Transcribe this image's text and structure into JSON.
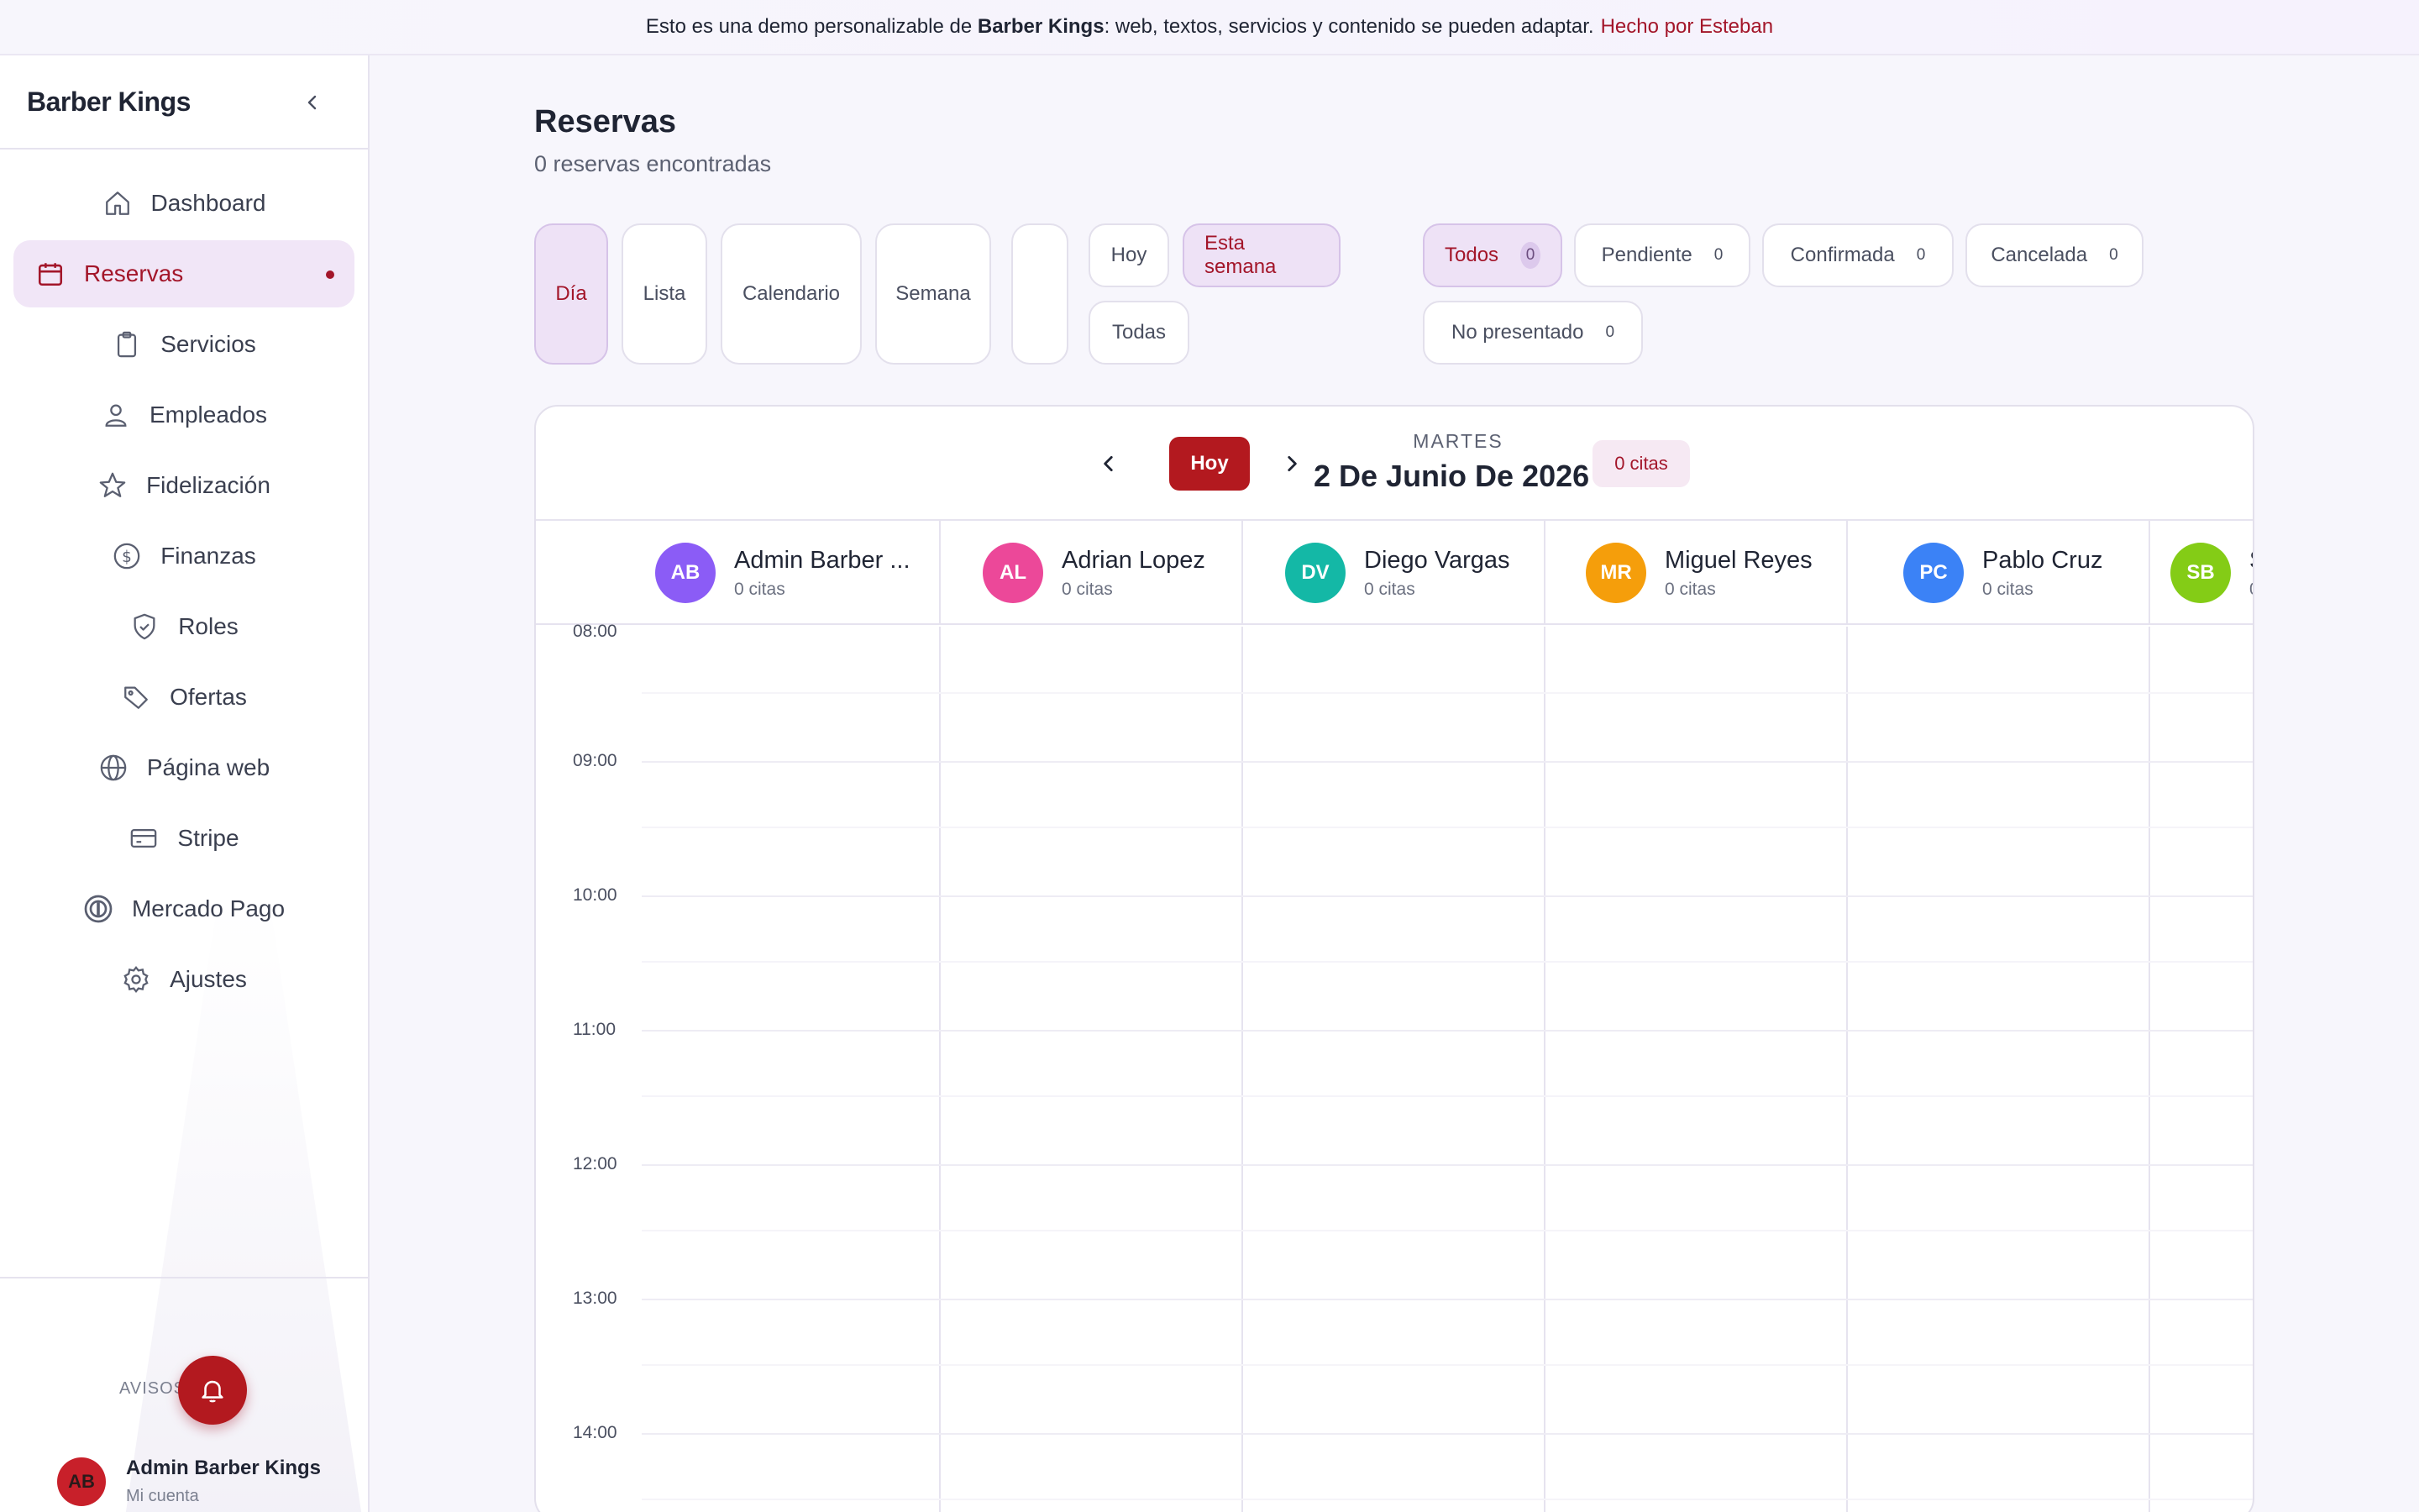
{
  "banner": {
    "prefix": "Esto es una demo personalizable de",
    "brand": "Barber Kings",
    "suffix": ": web, textos, servicios y contenido se pueden adaptar.",
    "credit": "Hecho por Esteban"
  },
  "sidebar": {
    "brand": "Barber Kings",
    "items": [
      {
        "label": "Dashboard",
        "icon": "home-icon"
      },
      {
        "label": "Reservas",
        "icon": "calendar-icon",
        "active": true
      },
      {
        "label": "Servicios",
        "icon": "clipboard-icon"
      },
      {
        "label": "Empleados",
        "icon": "users-icon"
      },
      {
        "label": "Fidelización",
        "icon": "star-icon"
      },
      {
        "label": "Finanzas",
        "icon": "dollar-icon"
      },
      {
        "label": "Roles",
        "icon": "shield-icon"
      },
      {
        "label": "Ofertas",
        "icon": "tag-icon"
      },
      {
        "label": "Página web",
        "icon": "globe-icon"
      },
      {
        "label": "Stripe",
        "icon": "card-icon"
      },
      {
        "label": "Mercado Pago",
        "icon": "mercado-pago-icon"
      },
      {
        "label": "Ajustes",
        "icon": "gear-icon"
      }
    ],
    "avisos_label": "AVISOS",
    "account": {
      "initials": "AB",
      "name": "Admin Barber Kings",
      "sub": "Mi cuenta"
    }
  },
  "main": {
    "title": "Reservas",
    "subtitle": "0 reservas encontradas",
    "view_tabs": [
      "Día",
      "Lista",
      "Calendario",
      "Semana",
      ""
    ],
    "range_pills": {
      "hoy": "Hoy",
      "semana": "Esta semana",
      "todas": "Todas"
    },
    "status_filters": [
      {
        "label": "Todos",
        "count": "0"
      },
      {
        "label": "Pendiente",
        "count": "0"
      },
      {
        "label": "Confirmada",
        "count": "0"
      },
      {
        "label": "Cancelada",
        "count": "0"
      },
      {
        "label": "No presentado",
        "count": "0"
      }
    ]
  },
  "calendar": {
    "today_button": "Hoy",
    "weekday": "MARTES",
    "date": "2 De Junio De 2026",
    "count_badge": "0 citas",
    "employees": [
      {
        "initials": "AB",
        "name": "Admin Barber ...",
        "sub": "0 citas",
        "color": "#8b5cf6"
      },
      {
        "initials": "AL",
        "name": "Adrian Lopez",
        "sub": "0 citas",
        "color": "#ec4899"
      },
      {
        "initials": "DV",
        "name": "Diego Vargas",
        "sub": "0 citas",
        "color": "#14b8a6"
      },
      {
        "initials": "MR",
        "name": "Miguel Reyes",
        "sub": "0 citas",
        "color": "#f59e0b"
      },
      {
        "initials": "PC",
        "name": "Pablo Cruz",
        "sub": "0 citas",
        "color": "#3b82f6"
      },
      {
        "initials": "SB",
        "name": "S",
        "sub": "0",
        "color": "#84cc16"
      }
    ],
    "hours": [
      "08:00",
      "09:00",
      "10:00",
      "11:00",
      "12:00",
      "13:00",
      "14:00"
    ]
  },
  "colors": {
    "accent": "#a3162a",
    "accent_bg": "#eee2f6",
    "bell": "#b3191f"
  }
}
